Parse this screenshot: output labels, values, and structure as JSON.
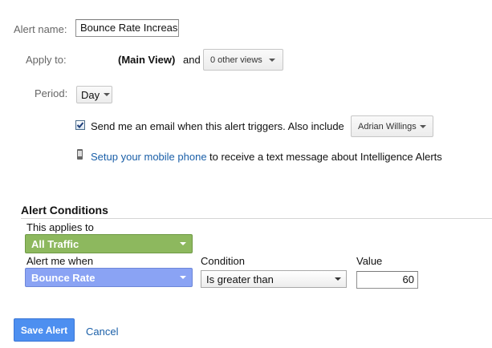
{
  "alert_name": {
    "label": "Alert name:",
    "value": "Bounce Rate Increase"
  },
  "apply_to": {
    "label": "Apply to:",
    "view": "(Main View)",
    "and": "and",
    "dropdown": "0 other views"
  },
  "period": {
    "label": "Period:",
    "value": "Day"
  },
  "email": {
    "checked": true,
    "text": "Send me an email when this alert triggers. Also include",
    "recipient": "Adrian Willings"
  },
  "mobile": {
    "link": "Setup your mobile phone",
    "rest": "to receive a text message about Intelligence Alerts"
  },
  "conditions": {
    "title": "Alert Conditions",
    "applies_label": "This applies to",
    "applies_value": "All Traffic",
    "alert_when_label": "Alert me when",
    "alert_when_value": "Bounce Rate",
    "condition_label": "Condition",
    "condition_value": "Is greater than",
    "value_label": "Value",
    "value": "60"
  },
  "actions": {
    "save": "Save Alert",
    "cancel": "Cancel"
  },
  "colors": {
    "all_traffic": "#8db85e",
    "bounce_rate": "#8aa3f4",
    "save": "#4d8ff0",
    "link": "#1a5fa8"
  }
}
